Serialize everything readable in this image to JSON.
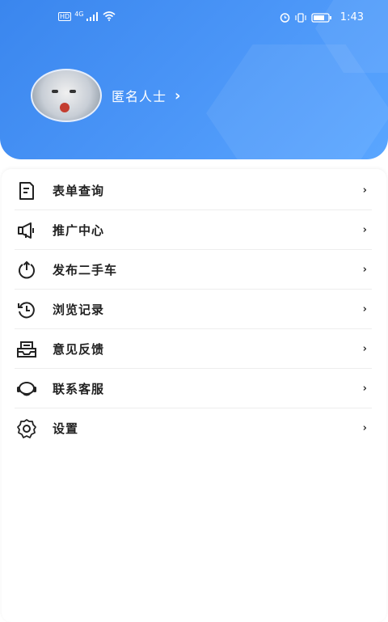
{
  "status_bar": {
    "left_badge": "HD",
    "network": "4G",
    "time": "1:43"
  },
  "profile": {
    "nickname": "匿名人士"
  },
  "menu": {
    "items": [
      {
        "label": "表单查询",
        "icon": "form-document-icon"
      },
      {
        "label": "推广中心",
        "icon": "megaphone-icon"
      },
      {
        "label": "发布二手车",
        "icon": "upload-icon"
      },
      {
        "label": "浏览记录",
        "icon": "history-icon"
      },
      {
        "label": "意见反馈",
        "icon": "feedback-inbox-icon"
      },
      {
        "label": "联系客服",
        "icon": "headset-icon"
      },
      {
        "label": "设置",
        "icon": "gear-icon"
      }
    ]
  },
  "colors": {
    "header_blue": "#4a95f7",
    "text": "#222222",
    "background": "#ffffff"
  }
}
